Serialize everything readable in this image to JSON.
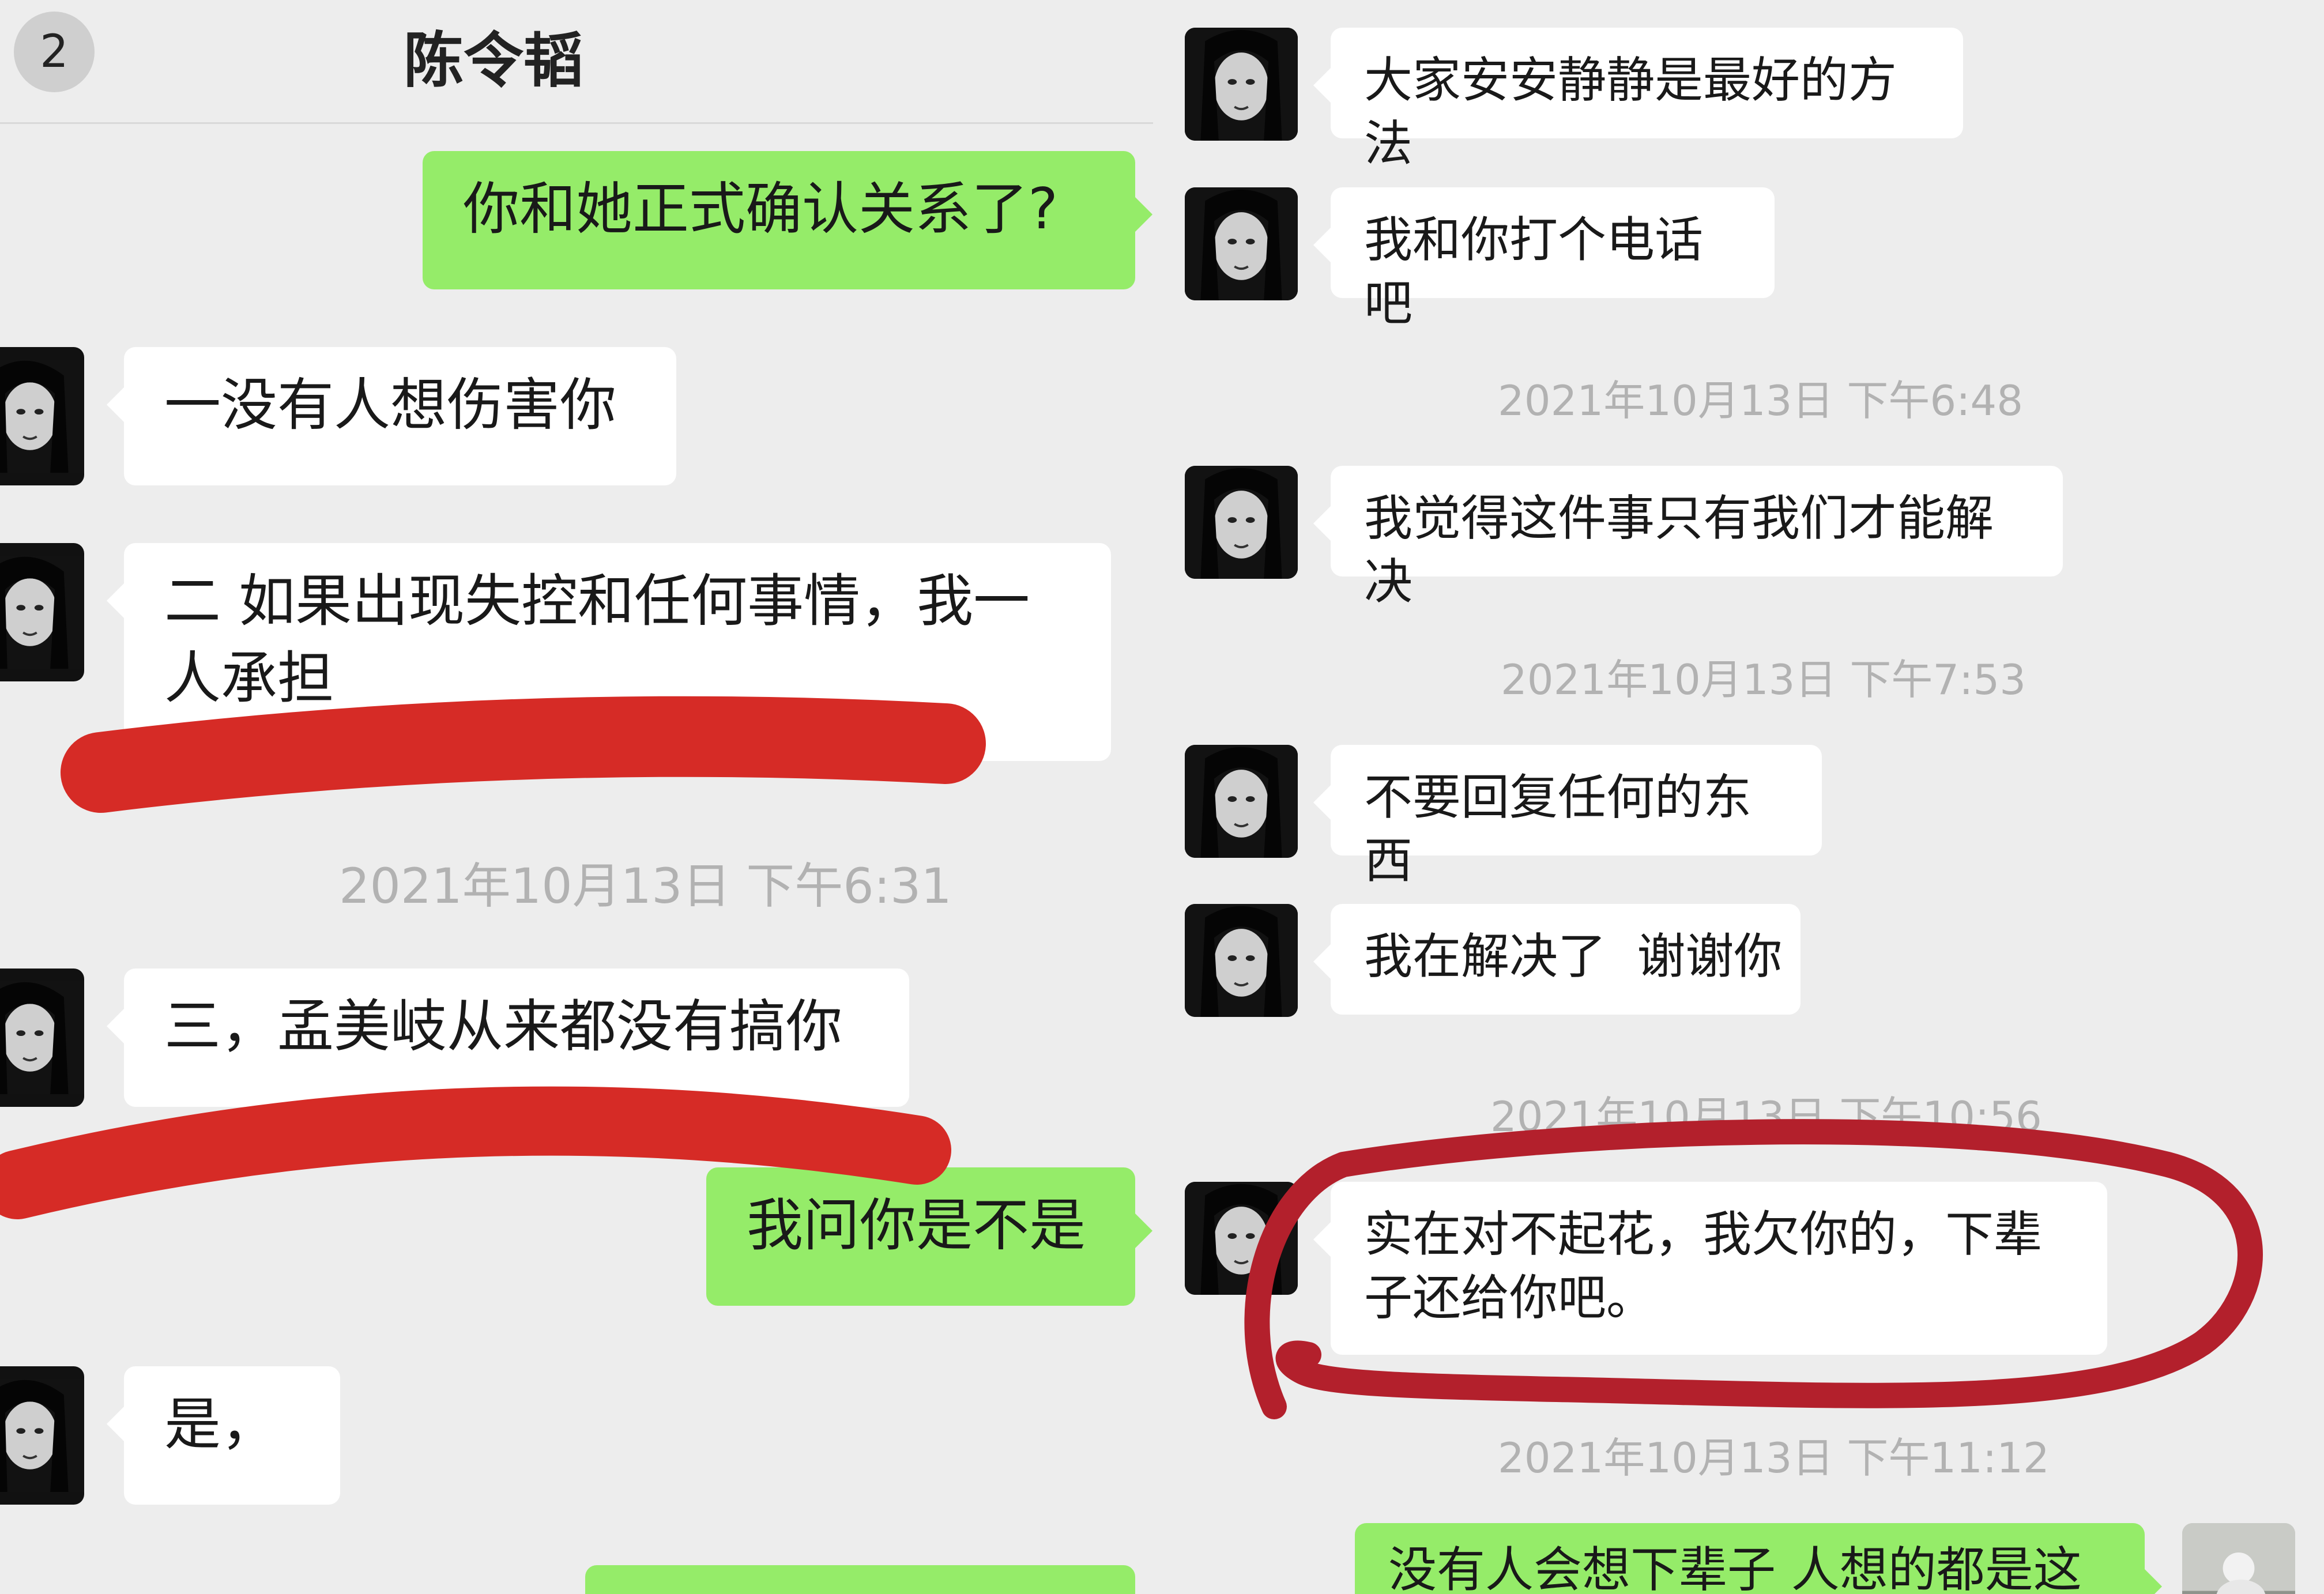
{
  "left": {
    "header": {
      "badge": "2",
      "title": "陈令韬"
    },
    "messages": [
      {
        "side": "out",
        "text": "你和她正式确认关系了?"
      },
      {
        "side": "in",
        "text": "一没有人想伤害你"
      },
      {
        "side": "in",
        "text": "二 如果出现失控和任何事情，我一人承担"
      },
      {
        "side": "timestamp",
        "text": "2021年10月13日 下午6:31"
      },
      {
        "side": "in",
        "text": "三，孟美岐从来都没有搞你"
      },
      {
        "side": "out",
        "text": "我问你是不是"
      },
      {
        "side": "in",
        "text": "是，"
      }
    ]
  },
  "right": {
    "messages": [
      {
        "side": "in",
        "text": "大家安安静静是最好的方法"
      },
      {
        "side": "in",
        "text": "我和你打个电话吧"
      },
      {
        "side": "timestamp",
        "text": "2021年10月13日 下午6:48"
      },
      {
        "side": "in",
        "text": "我觉得这件事只有我们才能解决"
      },
      {
        "side": "timestamp",
        "text": "2021年10月13日 下午7:53"
      },
      {
        "side": "in",
        "text": "不要回复任何的东西"
      },
      {
        "side": "in",
        "text": "我在解决了  谢谢你"
      },
      {
        "side": "timestamp",
        "text": "2021年10月13日 下午10:56"
      },
      {
        "side": "in",
        "text": "实在对不起花，我欠你的，下辈子还给你吧。"
      },
      {
        "side": "timestamp",
        "text": "2021年10月13日 下午11:12"
      },
      {
        "side": "out",
        "text": "没有人会想下辈子 人想的都是这辈"
      }
    ]
  },
  "colors": {
    "background": "#ededed",
    "incoming_bubble": "#ffffff",
    "outgoing_bubble": "#95ec69",
    "annotation_red": "#d62b26",
    "annotation_circle": "#b3202c",
    "timestamp_text": "#b2b2b2"
  },
  "icons": [
    "avatar-photo",
    "user-avatar-photo"
  ]
}
